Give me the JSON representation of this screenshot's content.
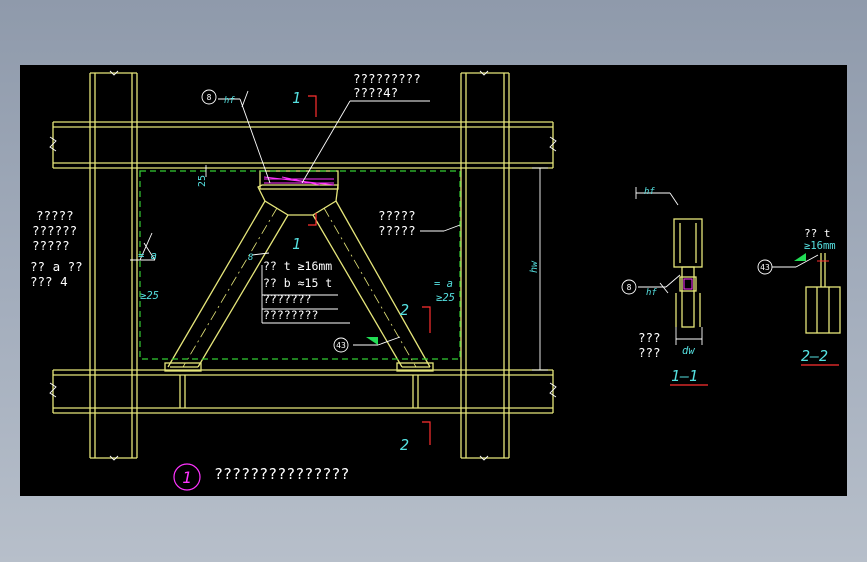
{
  "colors": {
    "background": "#000000",
    "structure": "#e6e67a",
    "dashed_outline": "#33cc33",
    "white_text": "#ffffff",
    "cyan_text": "#55e0e0",
    "red_marker": "#ff3030",
    "magenta": "#ff33ff",
    "green_flag": "#22dd55"
  },
  "annotations": {
    "top_note_line1": "?????????",
    "top_note_line2": "????4?",
    "left_note_line1": "?????",
    "left_note_line2": "??????",
    "left_note_line3": "?????",
    "left_note_line4": "?? a ??",
    "left_note_line5": "??? 4",
    "right_note_line1": "?????",
    "right_note_line2": "?????",
    "plate_thickness": "?? t ≥16mm",
    "plate_width": "?? b ≈15 t",
    "plate_note1": "???????",
    "plate_note2": "????????",
    "weld_a_left": "= a",
    "weld_ge_left": "≥25",
    "weld_a_right": "= a",
    "weld_ge_right": "≥25",
    "dim_25": "25",
    "dim_hw": "hw",
    "dim_dw": "dw",
    "weld_size": "hf",
    "label_8": "8",
    "label_8a": "8",
    "label_8b": "8",
    "label_43": "43",
    "label_43b": "43",
    "side_note1": "???",
    "side_note2": "???",
    "s22_note1": "?? t",
    "s22_note2": "≥16mm",
    "hf_right": "hf"
  },
  "section_marks": {
    "cut1_top": "1",
    "cut1_mid": "1",
    "cut2_right": "2",
    "cut2_bottom": "2"
  },
  "views": {
    "detail_number": "1",
    "detail_title": "???????????????",
    "section_1_1": "1—1",
    "section_2_2": "2—2"
  }
}
